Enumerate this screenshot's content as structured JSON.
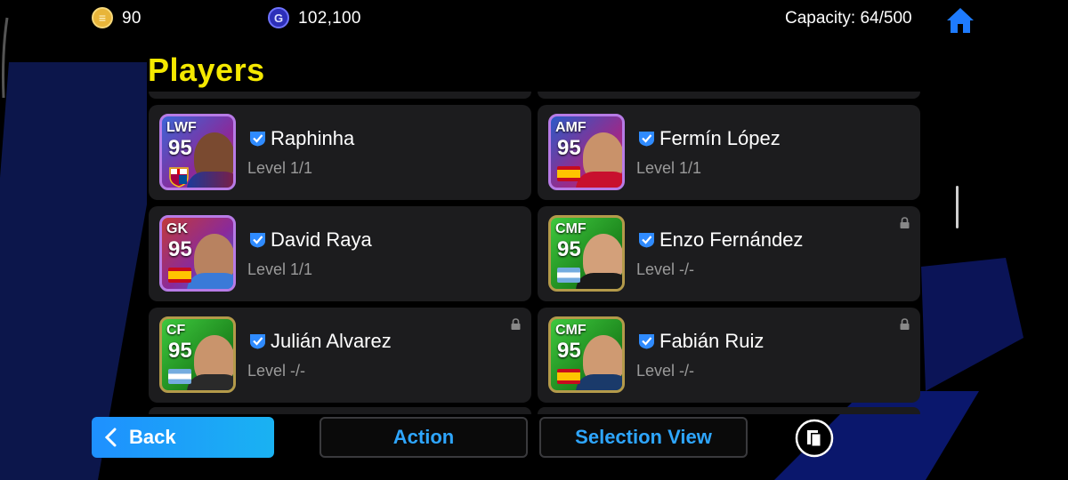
{
  "currency": {
    "coins": "90",
    "gp": "102,100"
  },
  "capacity": "Capacity: 64/500",
  "title": "Players",
  "players": [
    {
      "position": "LWF",
      "rating": "95",
      "name": "Raphinha",
      "level": "Level 1/1",
      "flag": "barcelona-crest",
      "locked": false
    },
    {
      "position": "AMF",
      "rating": "95",
      "name": "Fermín López",
      "level": "Level 1/1",
      "flag": "spain",
      "locked": false
    },
    {
      "position": "GK",
      "rating": "95",
      "name": "David Raya",
      "level": "Level 1/1",
      "flag": "spain",
      "locked": false
    },
    {
      "position": "CMF",
      "rating": "95",
      "name": "Enzo Fernández",
      "level": "Level -/-",
      "flag": "argentina",
      "locked": true
    },
    {
      "position": "CF",
      "rating": "95",
      "name": "Julián Alvarez",
      "level": "Level -/-",
      "flag": "argentina",
      "locked": true
    },
    {
      "position": "CMF",
      "rating": "95",
      "name": "Fabián Ruiz",
      "level": "Level -/-",
      "flag": "spain",
      "locked": true
    }
  ],
  "buttons": {
    "back": "Back",
    "action": "Action",
    "selection_view": "Selection View"
  },
  "colors": {
    "title": "#f4e800",
    "accent": "#2ea6ff",
    "back_button": "#1e90ff",
    "card_bg": "#1c1c1e",
    "verified": "#2f8bff"
  }
}
